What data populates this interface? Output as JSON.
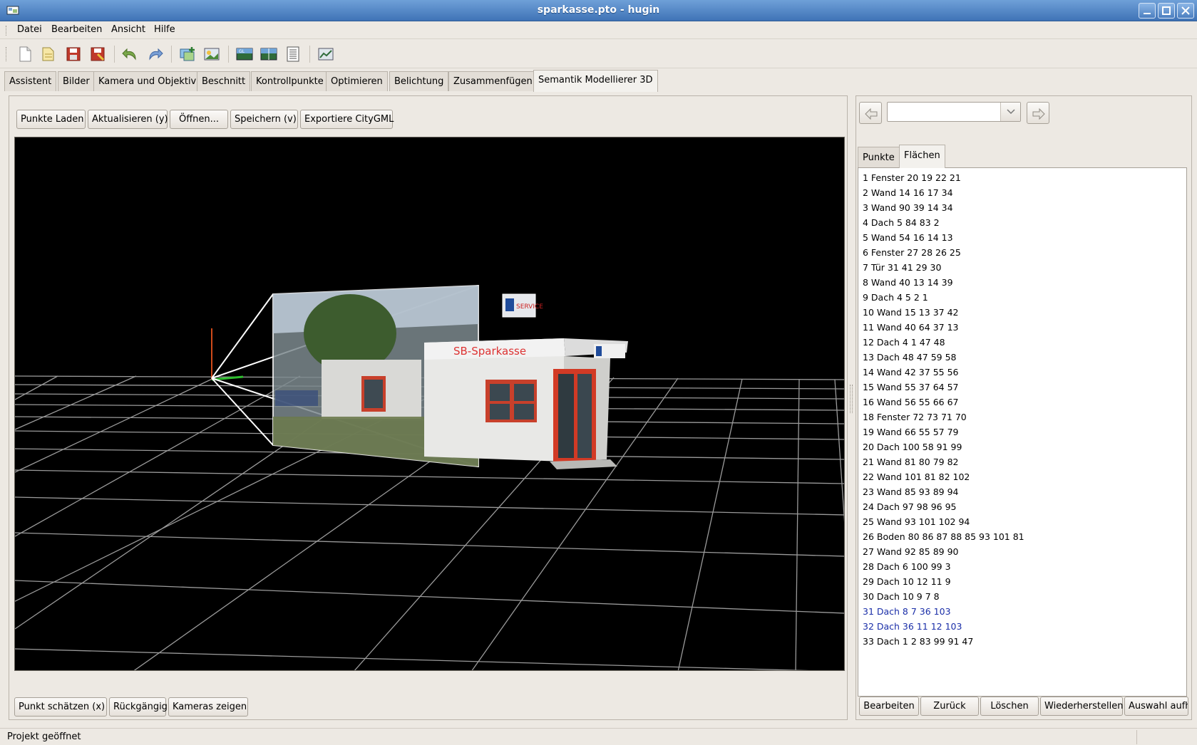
{
  "window": {
    "title": "sparkasse.pto - hugin"
  },
  "menu": [
    {
      "label": "Datei"
    },
    {
      "label": "Bearbeiten"
    },
    {
      "label": "Ansicht"
    },
    {
      "label": "Hilfe"
    }
  ],
  "toolbar_icons": [
    "new-icon",
    "open-icon",
    "save-icon",
    "save-as-icon",
    "undo-icon",
    "redo-icon",
    "add-images-icon",
    "add-image-series-icon",
    "gl-preview-icon",
    "fast-preview-icon",
    "panorama-list-icon",
    "run-optimizer-icon"
  ],
  "tabs": [
    {
      "label": "Assistent"
    },
    {
      "label": "Bilder"
    },
    {
      "label": "Kamera und Objektiv"
    },
    {
      "label": "Beschnitt"
    },
    {
      "label": "Kontrollpunkte"
    },
    {
      "label": "Optimieren"
    },
    {
      "label": "Belichtung"
    },
    {
      "label": "Zusammenfügen"
    },
    {
      "label": "Semantik Modellierer 3D",
      "active": true
    }
  ],
  "top_buttons": {
    "load": "Punkte Laden",
    "refresh": "Aktualisieren (y)",
    "open": "Öffnen...",
    "save": "Speichern (v)",
    "export": "Exportiere CityGML"
  },
  "bottom_buttons": {
    "estimate": "Punkt schätzen (x)",
    "undo": "Rückgängig",
    "cameras": "Kameras zeigen"
  },
  "side": {
    "combo_value": "",
    "tabs": [
      {
        "label": "Punkte"
      },
      {
        "label": "Flächen",
        "active": true
      }
    ],
    "faces": [
      "1 Fenster 20 19 22 21",
      "2 Wand 14 16 17 34",
      "3 Wand 90 39 14 34",
      "4 Dach 5 84 83 2",
      "5 Wand 54 16 14 13",
      "6 Fenster 27 28 26 25",
      "7 Tür 31 41 29 30",
      "8 Wand 40 13 14 39",
      "9 Dach 4 5 2 1",
      "10 Wand 15 13 37 42",
      "11 Wand 40 64 37 13",
      "12 Dach 4 1 47 48",
      "13 Dach 48 47 59 58",
      "14 Wand 42 37 55 56",
      "15 Wand 55 37 64 57",
      "16 Wand 56 55 66 67",
      "18 Fenster 72 73 71 70",
      "19 Wand 66 55 57 79",
      "20 Dach 100 58 91 99",
      "21 Wand 81 80 79 82",
      "22 Wand 101 81 82 102",
      "23 Wand 85 93 89 94",
      "24 Dach 97 98 96 95",
      "25 Wand 93 101 102 94",
      "26 Boden 80 86 87 88 85 93 101 81",
      "27 Wand 92 85 89 90",
      "28 Dach 6 100 99 3",
      "29 Dach 10 12 11 9",
      "30 Dach 10 9 7 8",
      "31 Dach 8 7 36 103",
      "32 Dach 36 11 12 103",
      "33 Dach 1 2 83 99 91 47"
    ],
    "buttons": {
      "edit": "Bearbeiten",
      "back": "Zurück",
      "delete": "Löschen",
      "restore": "Wiederherstellen",
      "deselect": "Auswahl aufh"
    }
  },
  "viewport": {
    "sign_text": "SB-Sparkasse",
    "billboard_text": "SERVICE"
  },
  "status": {
    "text": "Projekt geöffnet"
  }
}
